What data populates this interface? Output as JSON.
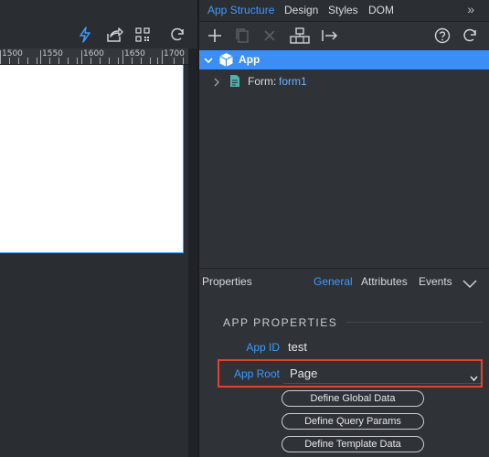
{
  "left_toolbar": {
    "icons": [
      "lightning-icon",
      "share-icon",
      "qr-code-icon",
      "refresh-icon"
    ]
  },
  "ruler": {
    "labels": [
      "1500",
      "1550",
      "1600",
      "1650",
      "1700"
    ]
  },
  "top_tabs": [
    "App Structure",
    "Design",
    "Styles",
    "DOM"
  ],
  "top_tabs_more": "»",
  "right_toolbar": {
    "icons": [
      "add-icon",
      "copy-icon",
      "delete-icon",
      "component-icon",
      "arrow-right-icon",
      "help-icon",
      "refresh-icon"
    ]
  },
  "tree": {
    "root_label": "App",
    "child_type": "Form:",
    "child_name": "form1"
  },
  "properties": {
    "title": "Properties",
    "tabs": [
      "General",
      "Attributes",
      "Events"
    ],
    "section": "APP PROPERTIES",
    "app_id_label": "App ID",
    "app_id_value": "test",
    "app_root_label": "App Root",
    "app_root_value": "Page",
    "buttons": [
      "Define Global Data",
      "Define Query Params",
      "Define Template Data"
    ]
  },
  "colors": {
    "accent": "#3e9bff",
    "selection": "#3a8ef6",
    "highlight_box": "#e8402c"
  }
}
